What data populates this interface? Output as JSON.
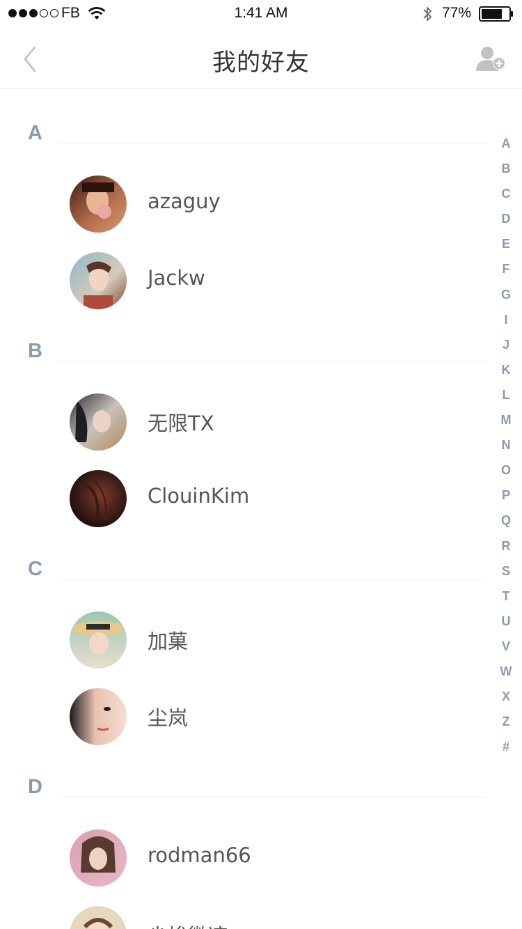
{
  "status_bar": {
    "carrier": "FB",
    "time": "1:41 AM",
    "battery": "77%",
    "battery_level": 0.77,
    "signal_bars": 3,
    "signal_total": 5
  },
  "nav": {
    "title": "我的好友",
    "back_icon": "chevron-left-icon",
    "action_icon": "add-user-icon"
  },
  "sections": [
    {
      "letter": "A",
      "friends": [
        {
          "name": "azaguy"
        },
        {
          "name": "Jackw"
        }
      ]
    },
    {
      "letter": "B",
      "friends": [
        {
          "name": "无限TX"
        },
        {
          "name": "ClouinKim"
        }
      ]
    },
    {
      "letter": "C",
      "friends": [
        {
          "name": "加菓"
        },
        {
          "name": "尘岚"
        }
      ]
    },
    {
      "letter": "D",
      "friends": [
        {
          "name": "rodman66"
        },
        {
          "name": "尘埃微凉"
        }
      ]
    }
  ],
  "index_letters": [
    "A",
    "B",
    "C",
    "D",
    "E",
    "F",
    "G",
    "I",
    "J",
    "K",
    "L",
    "M",
    "N",
    "O",
    "P",
    "Q",
    "R",
    "S",
    "T",
    "U",
    "V",
    "W",
    "X",
    "Z",
    "#"
  ],
  "colors": {
    "accent": "#8a9bab",
    "text": "#555555",
    "divider": "#ececec",
    "icon_gray": "#c2c2c2"
  }
}
